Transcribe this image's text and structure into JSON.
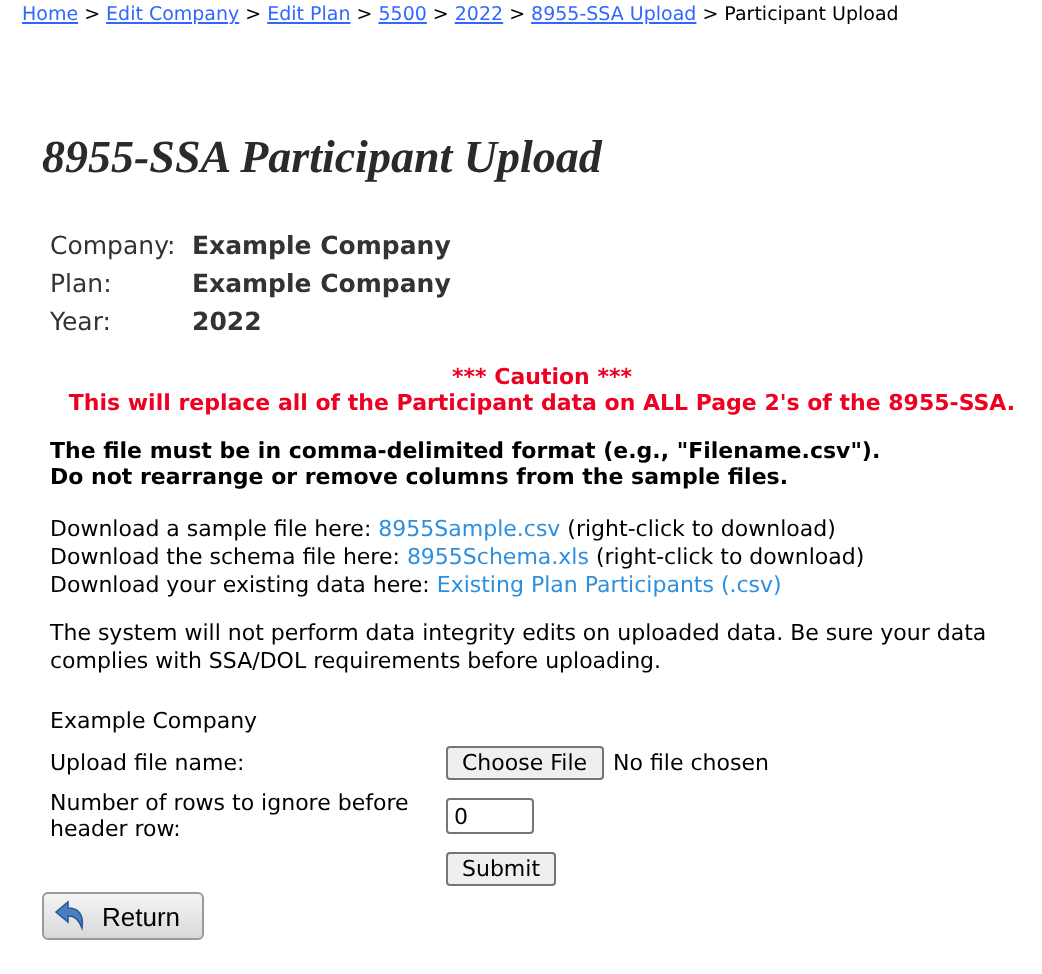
{
  "breadcrumb": [
    {
      "label": "Home",
      "kind": "link"
    },
    {
      "label": "Edit Company",
      "kind": "link"
    },
    {
      "label": "Edit Plan",
      "kind": "link"
    },
    {
      "label": "5500",
      "kind": "link"
    },
    {
      "label": "2022",
      "kind": "link"
    },
    {
      "label": "8955-SSA Upload",
      "kind": "link"
    },
    {
      "label": "Participant Upload",
      "kind": "current"
    }
  ],
  "separator": ">",
  "title": "8955-SSA Participant Upload",
  "info": [
    {
      "label": "Company:",
      "value": "Example Company"
    },
    {
      "label": "Plan:",
      "value": "Example Company"
    },
    {
      "label": "Year:",
      "value": "2022"
    }
  ],
  "caution": {
    "heading": "*** Caution ***",
    "message": "This will replace all of the Participant data on ALL Page 2's of the 8955-SSA."
  },
  "format_note": [
    "The file must be in comma-delimited format (e.g., \"Filename.csv\").",
    "Do not rearrange or remove columns from the sample files."
  ],
  "downloads": [
    {
      "prefix": "Download a sample file here:",
      "link": "8955Sample.csv",
      "suffix": "(right-click to download)"
    },
    {
      "prefix": "Download the schema file here:",
      "link": "8955Schema.xls",
      "suffix": "(right-click to download)"
    },
    {
      "prefix": "Download your existing data here:",
      "link": "Existing Plan Participants (.csv)"
    }
  ],
  "integrity_note": "The system will not perform data integrity edits on uploaded data. Be sure your data complies with SSA/DOL requirements before uploading.",
  "form": {
    "company": "Example Company",
    "upload_label": "Upload file name:",
    "choose_button": "Choose File",
    "file_status": "No file chosen",
    "rows_label": "Number of rows to ignore before header row:",
    "rows_value": "0",
    "submit": "Submit"
  },
  "return_button": "Return"
}
